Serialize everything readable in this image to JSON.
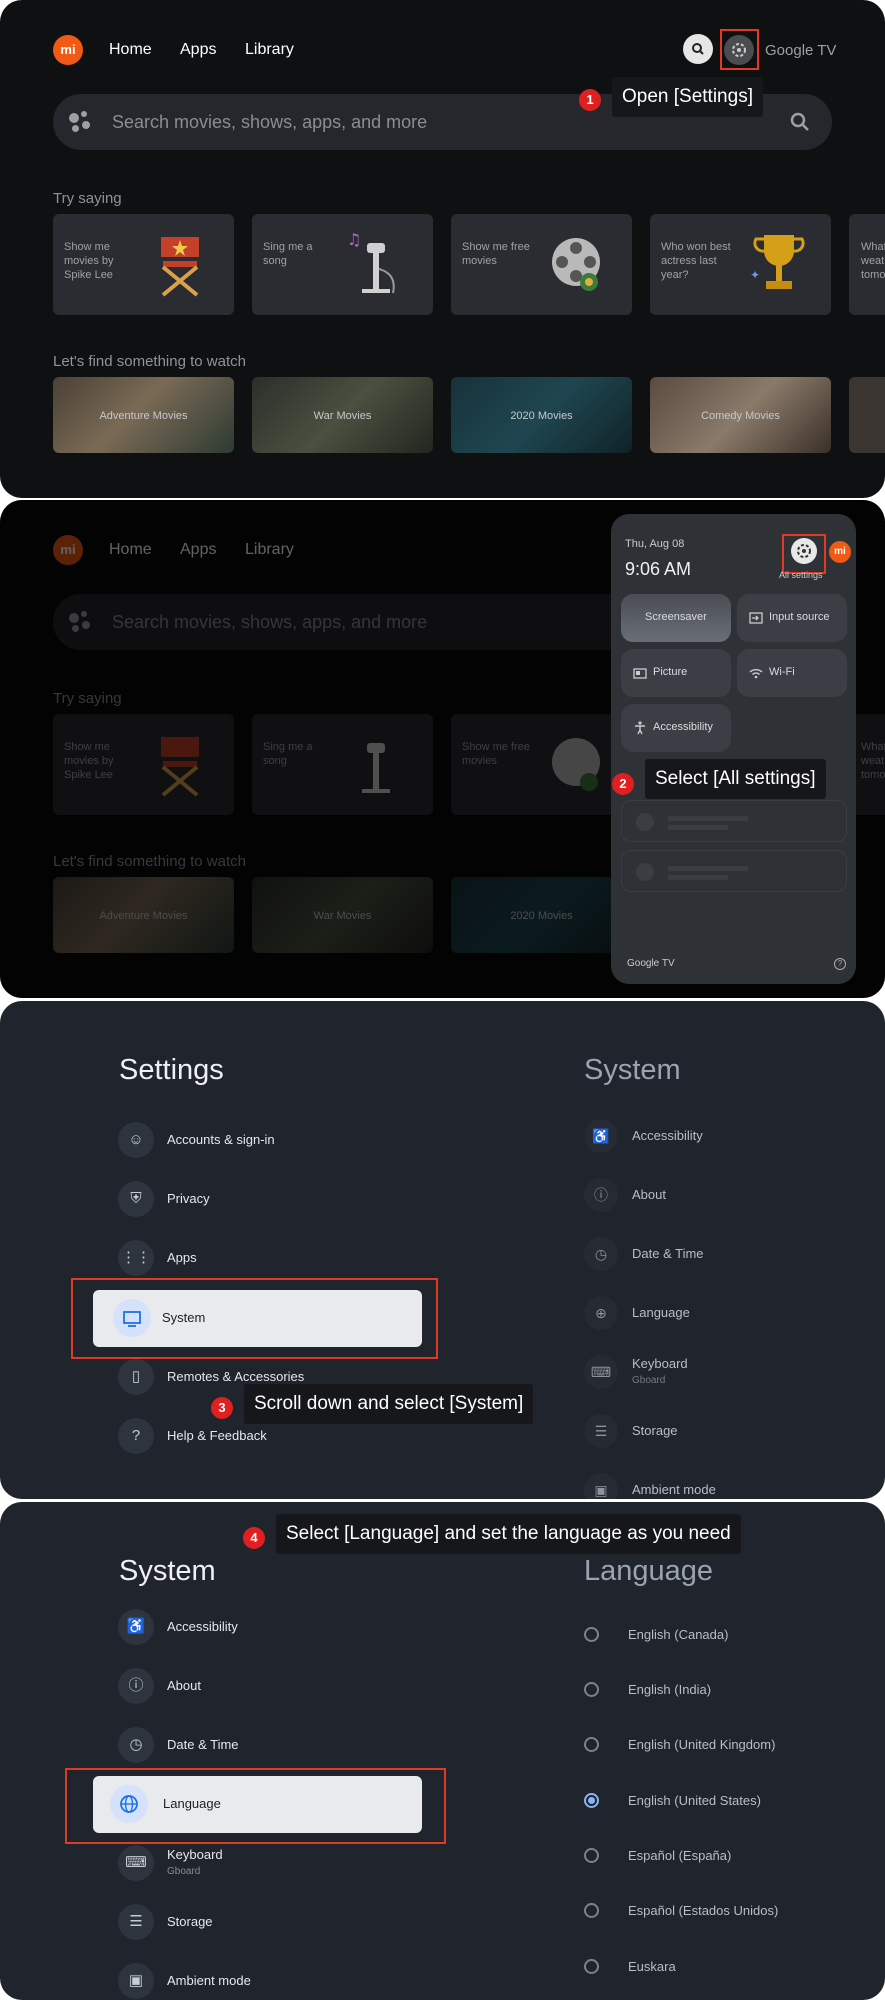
{
  "panel1": {
    "nav": [
      "Home",
      "Apps",
      "Library"
    ],
    "logo_text": "mi",
    "brand": "Google TV",
    "search_placeholder": "Search movies, shows, apps, and more",
    "try_saying_title": "Try saying",
    "suggestions": [
      "Show me movies by Spike Lee",
      "Sing me a song",
      "Show me free movies",
      "Who won best actress last year?",
      "What's the weather tomorrow"
    ],
    "find_title": "Let's find something to watch",
    "movies": [
      "Adventure Movies",
      "War Movies",
      "2020 Movies",
      "Comedy Movies"
    ],
    "step": {
      "number": "1",
      "text": "Open [Settings]"
    }
  },
  "panel2": {
    "date": "Thu, Aug 08",
    "time": "9:06 AM",
    "all_settings": "All settings",
    "tiles": [
      "Screensaver",
      "Input source",
      "Picture",
      "Wi-Fi",
      "Accessibility"
    ],
    "footer": "Google TV",
    "step": {
      "number": "2",
      "text": "Select [All settings]"
    }
  },
  "panel3": {
    "title_left": "Settings",
    "menu": [
      {
        "label": "Accounts & sign-in",
        "icon": "account-icon"
      },
      {
        "label": "Privacy",
        "icon": "shield-icon"
      },
      {
        "label": "Apps",
        "icon": "apps-grid-icon"
      },
      {
        "label": "System",
        "icon": "monitor-icon"
      },
      {
        "label": "Remotes & Accessories",
        "icon": "remote-icon"
      },
      {
        "label": "Help & Feedback",
        "icon": "help-icon"
      }
    ],
    "title_right": "System",
    "right_items": [
      {
        "label": "Accessibility",
        "sub": ""
      },
      {
        "label": "About",
        "sub": ""
      },
      {
        "label": "Date & Time",
        "sub": ""
      },
      {
        "label": "Language",
        "sub": ""
      },
      {
        "label": "Keyboard",
        "sub": "Gboard"
      },
      {
        "label": "Storage",
        "sub": ""
      },
      {
        "label": "Ambient mode",
        "sub": ""
      }
    ],
    "step": {
      "number": "3",
      "text": "Scroll down and select [System]"
    }
  },
  "panel4": {
    "title_left": "System",
    "menu": [
      {
        "label": "Accessibility",
        "sub": ""
      },
      {
        "label": "About",
        "sub": ""
      },
      {
        "label": "Date & Time",
        "sub": ""
      },
      {
        "label": "Language",
        "sub": ""
      },
      {
        "label": "Keyboard",
        "sub": "Gboard"
      },
      {
        "label": "Storage",
        "sub": ""
      },
      {
        "label": "Ambient mode",
        "sub": ""
      }
    ],
    "title_right": "Language",
    "languages": [
      {
        "label": "English (Canada)",
        "selected": false
      },
      {
        "label": "English (India)",
        "selected": false
      },
      {
        "label": "English (United Kingdom)",
        "selected": false
      },
      {
        "label": "English (United States)",
        "selected": true
      },
      {
        "label": "Español (España)",
        "selected": false
      },
      {
        "label": "Español (Estados Unidos)",
        "selected": false
      },
      {
        "label": "Euskara",
        "selected": false
      }
    ],
    "step": {
      "number": "4",
      "text": "Select [Language] and set the language as you need"
    }
  },
  "colors": {
    "accent_red": "#e03a22",
    "mi_orange": "#f05a14",
    "selected_blue": "#8ab4f8"
  }
}
